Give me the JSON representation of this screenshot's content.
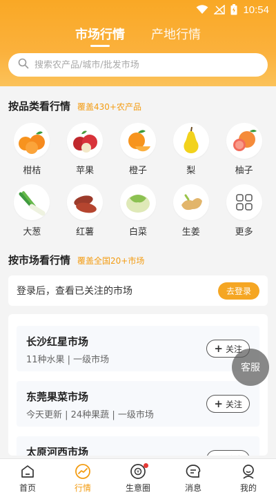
{
  "statusbar": {
    "time": "10:54"
  },
  "tabs": [
    {
      "label": "市场行情",
      "active": true
    },
    {
      "label": "产地行情",
      "active": false
    }
  ],
  "search": {
    "placeholder": "搜索农产品/城市/批发市场"
  },
  "category_section": {
    "title": "按品类看行情",
    "subtitle": "覆盖430+农产品"
  },
  "categories": [
    {
      "label": "柑桔",
      "icon": "tangerine-icon"
    },
    {
      "label": "苹果",
      "icon": "apple-icon"
    },
    {
      "label": "橙子",
      "icon": "orange-icon"
    },
    {
      "label": "梨",
      "icon": "pear-icon"
    },
    {
      "label": "柚子",
      "icon": "grapefruit-icon"
    },
    {
      "label": "大葱",
      "icon": "scallion-icon"
    },
    {
      "label": "红薯",
      "icon": "sweet-potato-icon"
    },
    {
      "label": "白菜",
      "icon": "cabbage-icon"
    },
    {
      "label": "生姜",
      "icon": "ginger-icon"
    },
    {
      "label": "更多",
      "icon": "grid-more-icon"
    }
  ],
  "market_section": {
    "title": "按市场看行情",
    "subtitle": "覆盖全国20+市场"
  },
  "login_prompt": {
    "text": "登录后，查看已关注的市场",
    "button": "去登录"
  },
  "markets": [
    {
      "name": "长沙红星市场",
      "meta": "11种水果 | 一级市场",
      "follow": "关注"
    },
    {
      "name": "东莞果菜市场",
      "meta": "今天更新 | 24种果蔬 | 一级市场",
      "follow": "关注"
    },
    {
      "name": "太原河西市场",
      "meta": "",
      "follow": "关注"
    }
  ],
  "floating": {
    "kefu": "客服"
  },
  "bottom_nav": [
    {
      "label": "首页",
      "icon": "home-icon",
      "active": false
    },
    {
      "label": "行情",
      "icon": "trend-icon",
      "active": true
    },
    {
      "label": "生意圈",
      "icon": "business-circle-icon",
      "active": false,
      "badge": true
    },
    {
      "label": "消息",
      "icon": "message-icon",
      "active": false
    },
    {
      "label": "我的",
      "icon": "profile-icon",
      "active": false
    }
  ],
  "colors": {
    "brand": "#f9a825",
    "accent": "#f39c12",
    "badge": "#e53935"
  }
}
